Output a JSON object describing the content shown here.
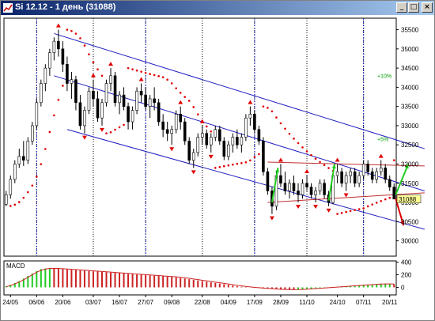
{
  "window": {
    "title": "Si 12.12 - 1 день (31088)",
    "minimize_glyph": "_",
    "maximize_glyph": "□",
    "close_glyph": "×"
  },
  "colors": {
    "title_bar": "#0a246a",
    "price_bar": "#000000",
    "sar_dot": "#e00000",
    "fractal_marker": "#e00000",
    "channel": "#2020c0",
    "range_line": "#c03030",
    "green_arrow": "#22cc22",
    "red_arrow": "#dd0000",
    "macd_positive": "#22cc22",
    "macd_negative": "#cc2222",
    "macd_signal": "#cc2222",
    "percent_label": "#00a000",
    "price_marker": "#ffff99"
  },
  "chart_data": {
    "type": "ohlc",
    "price_axis": {
      "ticks": [
        35500,
        35000,
        34500,
        34000,
        33500,
        33000,
        32500,
        32000,
        31500,
        31000,
        30500,
        30000
      ],
      "ylim": [
        29600,
        35800
      ],
      "current_price": "31088"
    },
    "date_axis": {
      "ticks": [
        "24/05",
        "06/06",
        "20/06",
        "03/07",
        "16/07",
        "27/07",
        "09/08",
        "22/08",
        "04/09",
        "17/09",
        "28/09",
        "11/10",
        "24/10",
        "07/11",
        "20/11"
      ]
    },
    "channel_labels": [
      "+10%",
      "+5%"
    ],
    "series": [
      {
        "values": [
          {
            "o": 30950,
            "h": 31300,
            "l": 30900,
            "c": 31200
          },
          {
            "o": 31200,
            "h": 31700,
            "l": 31100,
            "c": 31600
          },
          {
            "o": 31600,
            "h": 32100,
            "l": 31500,
            "c": 32000
          },
          {
            "o": 32000,
            "h": 32400,
            "l": 31900,
            "c": 32200
          },
          {
            "o": 32200,
            "h": 32600,
            "l": 31950,
            "c": 32100
          },
          {
            "o": 32100,
            "h": 32700,
            "l": 32000,
            "c": 32600
          },
          {
            "o": 32600,
            "h": 33100,
            "l": 32500,
            "c": 33000
          },
          {
            "o": 33000,
            "h": 33700,
            "l": 32900,
            "c": 33600
          },
          {
            "o": 33600,
            "h": 34200,
            "l": 33500,
            "c": 34100
          },
          {
            "o": 34100,
            "h": 34600,
            "l": 33900,
            "c": 34500
          },
          {
            "o": 34500,
            "h": 35000,
            "l": 34300,
            "c": 34900
          },
          {
            "o": 34900,
            "h": 35300,
            "l": 34700,
            "c": 35200
          },
          {
            "o": 35200,
            "h": 35500,
            "l": 34800,
            "c": 35000
          },
          {
            "o": 35000,
            "h": 35200,
            "l": 34400,
            "c": 34600
          },
          {
            "o": 34600,
            "h": 34800,
            "l": 33900,
            "c": 34100
          },
          {
            "o": 34100,
            "h": 34400,
            "l": 33700,
            "c": 34200
          },
          {
            "o": 34200,
            "h": 34300,
            "l": 33400,
            "c": 33600
          },
          {
            "o": 33600,
            "h": 33800,
            "l": 32900,
            "c": 33000
          },
          {
            "o": 33000,
            "h": 33500,
            "l": 32800,
            "c": 33400
          },
          {
            "o": 33400,
            "h": 34000,
            "l": 33300,
            "c": 33900
          },
          {
            "o": 33900,
            "h": 34200,
            "l": 33500,
            "c": 33700
          },
          {
            "o": 33700,
            "h": 33900,
            "l": 33100,
            "c": 33200
          },
          {
            "o": 33200,
            "h": 33700,
            "l": 33000,
            "c": 33600
          },
          {
            "o": 33600,
            "h": 34200,
            "l": 33500,
            "c": 34100
          },
          {
            "o": 34100,
            "h": 34500,
            "l": 33900,
            "c": 34300
          },
          {
            "o": 34300,
            "h": 34400,
            "l": 33500,
            "c": 33600
          },
          {
            "o": 33600,
            "h": 33900,
            "l": 33300,
            "c": 33800
          },
          {
            "o": 33800,
            "h": 34000,
            "l": 33400,
            "c": 33500
          },
          {
            "o": 33500,
            "h": 33600,
            "l": 32900,
            "c": 33100
          },
          {
            "o": 33100,
            "h": 33500,
            "l": 32900,
            "c": 33400
          },
          {
            "o": 33400,
            "h": 34000,
            "l": 33300,
            "c": 33900
          },
          {
            "o": 33900,
            "h": 34100,
            "l": 33600,
            "c": 33800
          },
          {
            "o": 33800,
            "h": 34000,
            "l": 33400,
            "c": 33500
          },
          {
            "o": 33500,
            "h": 33800,
            "l": 33200,
            "c": 33700
          },
          {
            "o": 33700,
            "h": 34000,
            "l": 33400,
            "c": 33600
          },
          {
            "o": 33600,
            "h": 33700,
            "l": 33000,
            "c": 33100
          },
          {
            "o": 33100,
            "h": 33300,
            "l": 32700,
            "c": 32900
          },
          {
            "o": 32900,
            "h": 33100,
            "l": 32600,
            "c": 32800
          },
          {
            "o": 32800,
            "h": 33000,
            "l": 32500,
            "c": 32900
          },
          {
            "o": 32900,
            "h": 33400,
            "l": 32800,
            "c": 33300
          },
          {
            "o": 33300,
            "h": 33500,
            "l": 32900,
            "c": 33100
          },
          {
            "o": 33100,
            "h": 33200,
            "l": 32500,
            "c": 32600
          },
          {
            "o": 32600,
            "h": 32700,
            "l": 32000,
            "c": 32100
          },
          {
            "o": 32100,
            "h": 32400,
            "l": 31900,
            "c": 32300
          },
          {
            "o": 32300,
            "h": 32800,
            "l": 32200,
            "c": 32700
          },
          {
            "o": 32700,
            "h": 33000,
            "l": 32500,
            "c": 32800
          },
          {
            "o": 32800,
            "h": 32900,
            "l": 32400,
            "c": 32500
          },
          {
            "o": 32500,
            "h": 32800,
            "l": 32300,
            "c": 32700
          },
          {
            "o": 32700,
            "h": 33000,
            "l": 32600,
            "c": 32900
          },
          {
            "o": 32900,
            "h": 33000,
            "l": 32500,
            "c": 32600
          },
          {
            "o": 32600,
            "h": 32700,
            "l": 32100,
            "c": 32200
          },
          {
            "o": 32200,
            "h": 32600,
            "l": 32100,
            "c": 32500
          },
          {
            "o": 32500,
            "h": 32800,
            "l": 32300,
            "c": 32700
          },
          {
            "o": 32700,
            "h": 32900,
            "l": 32400,
            "c": 32500
          },
          {
            "o": 32500,
            "h": 32800,
            "l": 32300,
            "c": 32700
          },
          {
            "o": 32700,
            "h": 33300,
            "l": 32600,
            "c": 33200
          },
          {
            "o": 33200,
            "h": 33500,
            "l": 33000,
            "c": 33300
          },
          {
            "o": 33300,
            "h": 33400,
            "l": 32800,
            "c": 32900
          },
          {
            "o": 32900,
            "h": 33000,
            "l": 32500,
            "c": 32600
          },
          {
            "o": 32600,
            "h": 32700,
            "l": 31700,
            "c": 31800
          },
          {
            "o": 31800,
            "h": 31900,
            "l": 31200,
            "c": 31300
          },
          {
            "o": 31300,
            "h": 31400,
            "l": 30700,
            "c": 30900
          },
          {
            "o": 30900,
            "h": 31800,
            "l": 30800,
            "c": 31700
          },
          {
            "o": 31700,
            "h": 32000,
            "l": 31400,
            "c": 31500
          },
          {
            "o": 31500,
            "h": 31800,
            "l": 31200,
            "c": 31300
          },
          {
            "o": 31300,
            "h": 31600,
            "l": 31100,
            "c": 31500
          },
          {
            "o": 31500,
            "h": 31700,
            "l": 31200,
            "c": 31300
          },
          {
            "o": 31300,
            "h": 31500,
            "l": 31000,
            "c": 31200
          },
          {
            "o": 31200,
            "h": 31600,
            "l": 31100,
            "c": 31500
          },
          {
            "o": 31500,
            "h": 31700,
            "l": 31300,
            "c": 31400
          },
          {
            "o": 31400,
            "h": 31500,
            "l": 31100,
            "c": 31200
          },
          {
            "o": 31200,
            "h": 31400,
            "l": 31000,
            "c": 31300
          },
          {
            "o": 31300,
            "h": 31600,
            "l": 31200,
            "c": 31500
          },
          {
            "o": 31500,
            "h": 31600,
            "l": 31100,
            "c": 31200
          },
          {
            "o": 31200,
            "h": 31300,
            "l": 30900,
            "c": 31000
          },
          {
            "o": 31000,
            "h": 31800,
            "l": 30950,
            "c": 31700
          },
          {
            "o": 31700,
            "h": 32000,
            "l": 31500,
            "c": 31800
          },
          {
            "o": 31800,
            "h": 31900,
            "l": 31400,
            "c": 31500
          },
          {
            "o": 31500,
            "h": 31800,
            "l": 31300,
            "c": 31700
          },
          {
            "o": 31700,
            "h": 31900,
            "l": 31500,
            "c": 31800
          },
          {
            "o": 31800,
            "h": 31900,
            "l": 31400,
            "c": 31500
          },
          {
            "o": 31500,
            "h": 31800,
            "l": 31400,
            "c": 31700
          },
          {
            "o": 31700,
            "h": 32100,
            "l": 31600,
            "c": 32000
          },
          {
            "o": 32000,
            "h": 32100,
            "l": 31700,
            "c": 31800
          },
          {
            "o": 31800,
            "h": 31900,
            "l": 31500,
            "c": 31600
          },
          {
            "o": 31600,
            "h": 31900,
            "l": 31500,
            "c": 31800
          },
          {
            "o": 31800,
            "h": 32100,
            "l": 31700,
            "c": 31900
          },
          {
            "o": 31900,
            "h": 32000,
            "l": 31500,
            "c": 31600
          },
          {
            "o": 31600,
            "h": 31700,
            "l": 31300,
            "c": 31400
          },
          {
            "o": 31400,
            "h": 31500,
            "l": 31100,
            "c": 31088
          }
        ]
      }
    ],
    "macd": {
      "label": "MACD",
      "ticks": [
        400,
        200,
        0
      ],
      "ylim": [
        -120,
        420
      ],
      "histogram": [
        20,
        40,
        70,
        100,
        140,
        180,
        220,
        260,
        290,
        300,
        305,
        300,
        295,
        290,
        285,
        280,
        275,
        270,
        265,
        260,
        255,
        250,
        245,
        240,
        235,
        230,
        225,
        220,
        215,
        210,
        205,
        200,
        195,
        190,
        185,
        180,
        175,
        170,
        165,
        160,
        150,
        140,
        130,
        120,
        110,
        100,
        90,
        80,
        70,
        60,
        50,
        40,
        30,
        20,
        10,
        5,
        0,
        -5,
        -10,
        -15,
        -20,
        -25,
        -30,
        -35,
        -38,
        -40,
        -38,
        -35,
        -30,
        -25,
        -20,
        -15,
        -10,
        -5,
        0,
        5,
        10,
        15,
        20,
        25,
        30,
        35,
        40,
        45,
        50,
        55,
        60,
        60,
        55,
        50
      ],
      "signal": [
        10,
        30,
        55,
        85,
        120,
        160,
        200,
        240,
        270,
        290,
        300,
        302,
        300,
        296,
        292,
        287,
        282,
        277,
        272,
        267,
        262,
        257,
        252,
        247,
        242,
        237,
        232,
        227,
        222,
        217,
        212,
        207,
        202,
        197,
        192,
        187,
        182,
        177,
        172,
        167,
        160,
        152,
        143,
        133,
        123,
        113,
        103,
        93,
        83,
        73,
        63,
        53,
        43,
        33,
        23,
        15,
        7,
        0,
        -6,
        -11,
        -16,
        -21,
        -26,
        -30,
        -34,
        -36,
        -37,
        -36,
        -33,
        -29,
        -25,
        -20,
        -15,
        -10,
        -5,
        0,
        4,
        9,
        14,
        19,
        24,
        29,
        34,
        39,
        44,
        48,
        52,
        54,
        54,
        52
      ]
    }
  }
}
